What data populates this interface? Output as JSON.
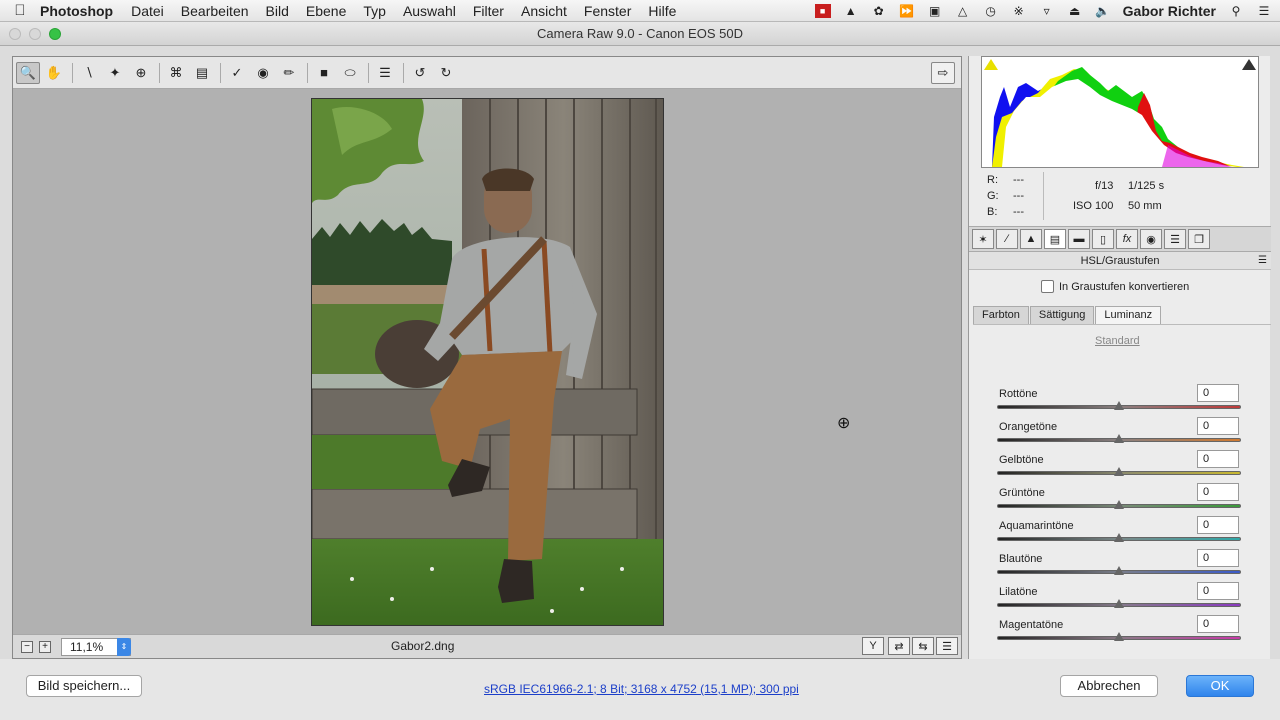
{
  "menubar": {
    "apple": "",
    "app": "Photoshop",
    "menus": [
      "Datei",
      "Bearbeiten",
      "Bild",
      "Ebene",
      "Typ",
      "Auswahl",
      "Filter",
      "Ansicht",
      "Fenster",
      "Hilfe"
    ],
    "user": "Gabor Richter"
  },
  "window": {
    "title": "Camera Raw 9.0 - Canon EOS 50D"
  },
  "preview": {
    "zoom": "11,1%",
    "filename": "Gabor2.dng"
  },
  "readout": {
    "r_label": "R:",
    "g_label": "G:",
    "b_label": "B:",
    "r_value": "---",
    "g_value": "---",
    "b_value": "---",
    "aperture": "f/13",
    "shutter": "1/125 s",
    "iso": "ISO 100",
    "focal": "50 mm"
  },
  "panel": {
    "title": "HSL/Graustufen",
    "grayscale_label": "In Graustufen konvertieren",
    "subtabs": [
      "Farbton",
      "Sättigung",
      "Luminanz"
    ],
    "default_link": "Standard",
    "sliders": [
      {
        "label": "Rottöne",
        "value": "0"
      },
      {
        "label": "Orangetöne",
        "value": "0"
      },
      {
        "label": "Gelbtöne",
        "value": "0"
      },
      {
        "label": "Grüntöne",
        "value": "0"
      },
      {
        "label": "Aquamarintöne",
        "value": "0"
      },
      {
        "label": "Blautöne",
        "value": "0"
      },
      {
        "label": "Lilatöne",
        "value": "0"
      },
      {
        "label": "Magentatöne",
        "value": "0"
      }
    ]
  },
  "bottom": {
    "save_label": "Bild speichern...",
    "workflow": "sRGB IEC61966-2.1; 8 Bit; 3168 x 4752 (15,1 MP); 300 ppi",
    "cancel_label": "Abbrechen",
    "ok_label": "OK"
  },
  "colors": {
    "accent": "#2f84ec",
    "link": "#1c3fc9"
  }
}
